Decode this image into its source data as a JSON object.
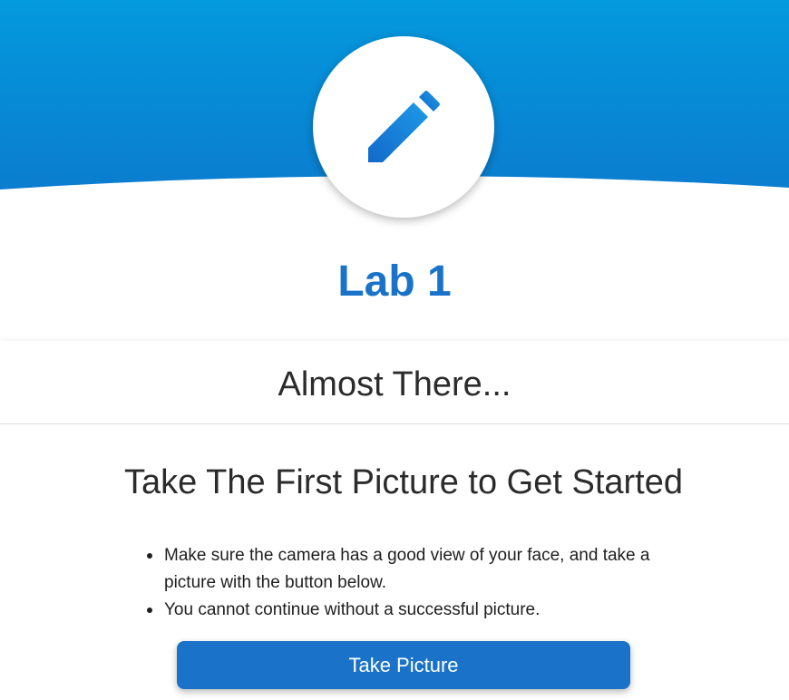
{
  "colors": {
    "banner_top": "#0399dd",
    "banner_bottom": "#0b7dcf",
    "accent": "#1a73c8",
    "pencil_light": "#1e9ae8",
    "pencil_dark": "#1269c9"
  },
  "header": {
    "icon": "pencil-icon",
    "title": "Lab 1"
  },
  "card": {
    "title": "Almost There...",
    "heading": "Take The First Picture to Get Started",
    "instructions": [
      "Make sure the camera has a good view of your face, and take a picture with the button below.",
      "You cannot continue without a successful picture."
    ],
    "button_label": "Take Picture"
  }
}
